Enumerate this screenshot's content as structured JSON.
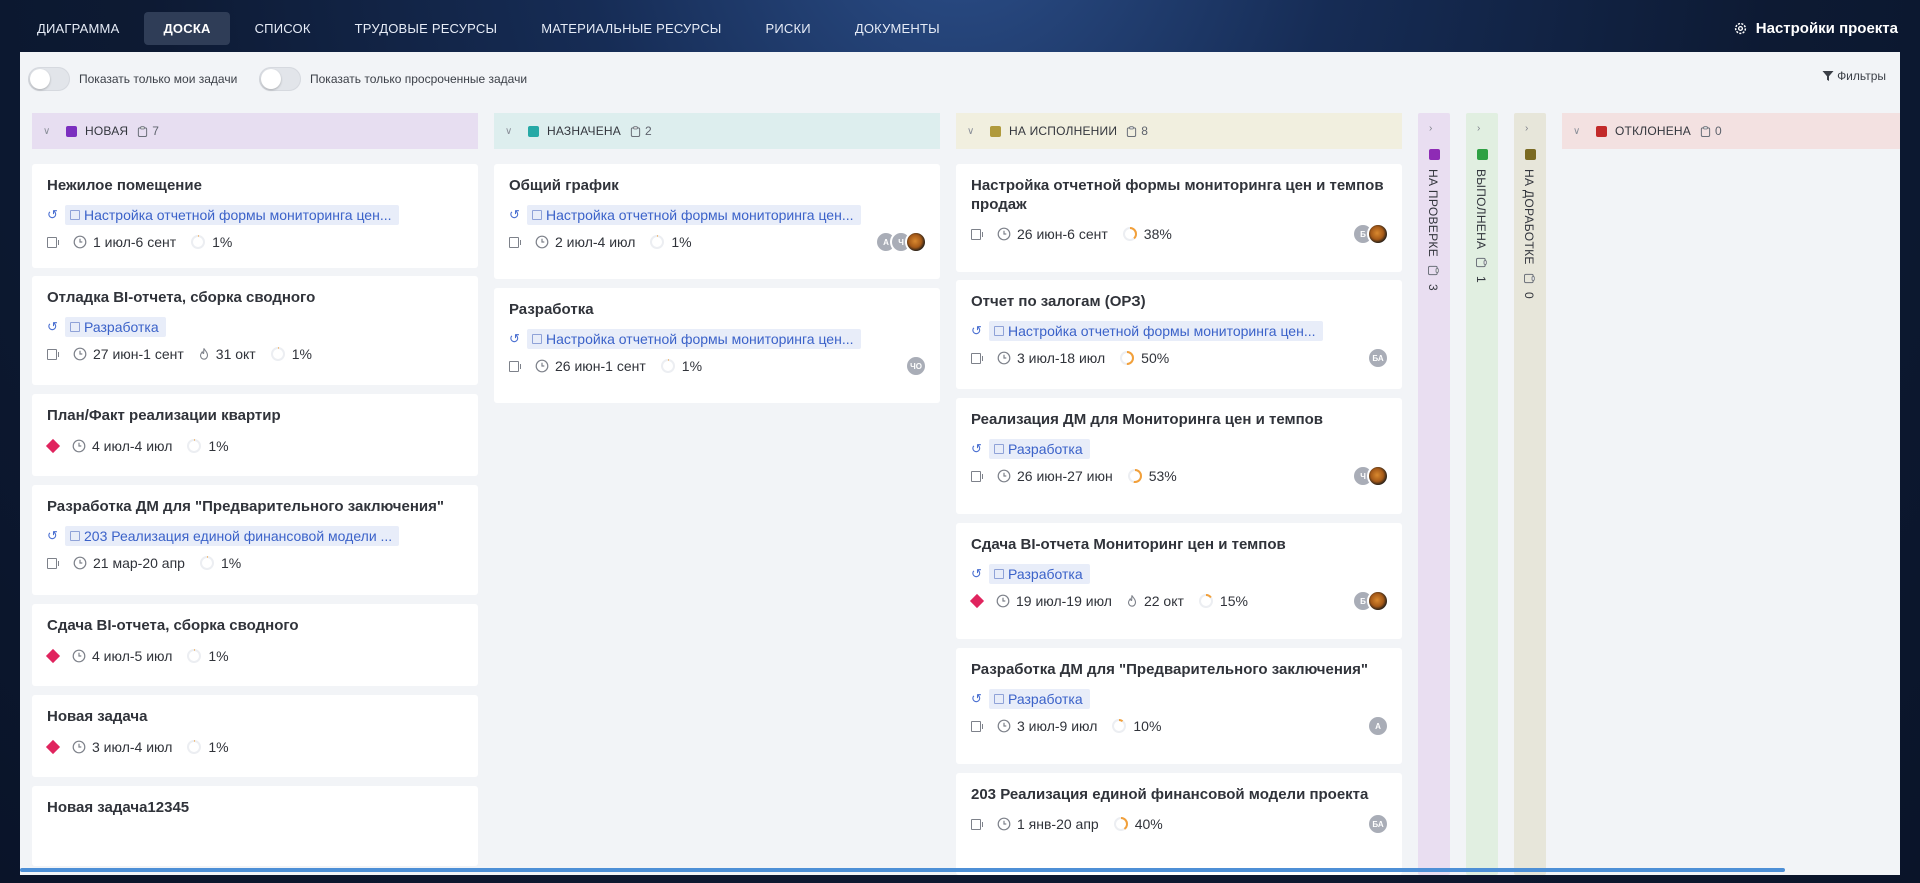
{
  "nav": {
    "tabs": [
      "ДИАГРАММА",
      "ДОСКА",
      "СПИСОК",
      "ТРУДОВЫЕ РЕСУРСЫ",
      "МАТЕРИАЛЬНЫЕ РЕСУРСЫ",
      "РИСКИ",
      "ДОКУМЕНТЫ"
    ],
    "active_tab": "ДОСКА",
    "settings_label": "Настройки проекта"
  },
  "toolbar": {
    "toggle_my_tasks": "Показать только мои задачи",
    "toggle_overdue": "Показать только просроченные задачи",
    "filters": "Фильтры"
  },
  "columns": {
    "new": {
      "title": "НОВАЯ",
      "count": "7",
      "color": "#7b2fbf",
      "cards": [
        {
          "title": "Нежилое помещение",
          "parent": "Настройка отчетной формы мониторинга цен...",
          "dates": "1 июл-6 сент",
          "progress": "1%",
          "progress_value": 0.01
        },
        {
          "title": "Отладка BI-отчета, сборка сводного",
          "parent": "Разработка",
          "dates": "27 июн-1 сент",
          "due": "31 окт",
          "progress": "1%",
          "progress_value": 0.01
        },
        {
          "title": "План/Факт реализации квартир",
          "dates": "4 июл-4 июл",
          "progress": "1%",
          "progress_value": 0.01
        },
        {
          "title": "Разработка ДМ для \"Предварительного заключения\"",
          "parent": "203 Реализация единой финансовой модели ...",
          "dates": "21 мар-20 апр",
          "progress": "1%",
          "progress_value": 0.01
        },
        {
          "title": "Сдача BI-отчета, сборка сводного",
          "dates": "4 июл-5 июл",
          "progress": "1%",
          "progress_value": 0.01
        },
        {
          "title": "Новая задача",
          "dates": "3 июл-4 июл",
          "progress": "1%",
          "progress_value": 0.01
        },
        {
          "title": "Новая задача12345"
        }
      ]
    },
    "assigned": {
      "title": "НАЗНАЧЕНА",
      "count": "2",
      "color": "#26a9a6",
      "cards": [
        {
          "title": "Общий график",
          "parent": "Настройка отчетной формы мониторинга цен...",
          "dates": "2 июл-4 июл",
          "progress": "1%",
          "progress_value": 0.01,
          "avatars": [
            "А",
            "Ч"
          ]
        },
        {
          "title": "Разработка",
          "parent": "Настройка отчетной формы мониторинга цен...",
          "dates": "26 июн-1 сент",
          "progress": "1%",
          "progress_value": 0.01,
          "avatars": [
            "ЧО"
          ]
        }
      ]
    },
    "in_progress": {
      "title": "НА ИСПОЛНЕНИИ",
      "count": "8",
      "color": "#b09a3c",
      "cards": [
        {
          "title": "Настройка отчетной формы мониторинга цен и темпов продаж",
          "dates": "26 июн-6 сент",
          "progress": "38%",
          "progress_value": 0.38,
          "avatars": [
            "Б"
          ]
        },
        {
          "title": "Отчет по залогам (ОРЗ)",
          "parent": "Настройка отчетной формы мониторинга цен...",
          "dates": "3 июл-18 июл",
          "progress": "50%",
          "progress_value": 0.5,
          "avatars": [
            "БА"
          ]
        },
        {
          "title": "Реализация ДМ для Мониторинга цен и темпов",
          "parent": "Разработка",
          "dates": "26 июн-27 июн",
          "progress": "53%",
          "progress_value": 0.53,
          "avatars": [
            "Ч"
          ]
        },
        {
          "title": "Сдача BI-отчета Мониторинг цен и темпов",
          "parent": "Разработка",
          "dates": "19 июл-19 июл",
          "due": "22 окт",
          "progress": "15%",
          "progress_value": 0.15,
          "avatars": [
            "Б"
          ]
        },
        {
          "title": "Разработка ДМ для \"Предварительного заключения\"",
          "parent": "Разработка",
          "dates": "3 июл-9 июл",
          "progress": "10%",
          "progress_value": 0.1,
          "avatars": [
            "А"
          ]
        },
        {
          "title": "203 Реализация единой финансовой модели проекта",
          "dates": "1 янв-20 апр",
          "progress": "40%",
          "progress_value": 0.4,
          "avatars": [
            "БА"
          ]
        }
      ]
    },
    "review": {
      "title": "НА ПРОВЕРКЕ",
      "count": "3",
      "color": "#8e2bb5"
    },
    "done": {
      "title": "ВЫПОЛНЕНА",
      "count": "1",
      "color": "#2ea043"
    },
    "rework": {
      "title": "НА ДОРАБОТКЕ",
      "count": "0",
      "color": "#7a6a22"
    },
    "rejected": {
      "title": "ОТКЛОНЕНА",
      "count": "0",
      "color": "#c22a2a"
    }
  }
}
